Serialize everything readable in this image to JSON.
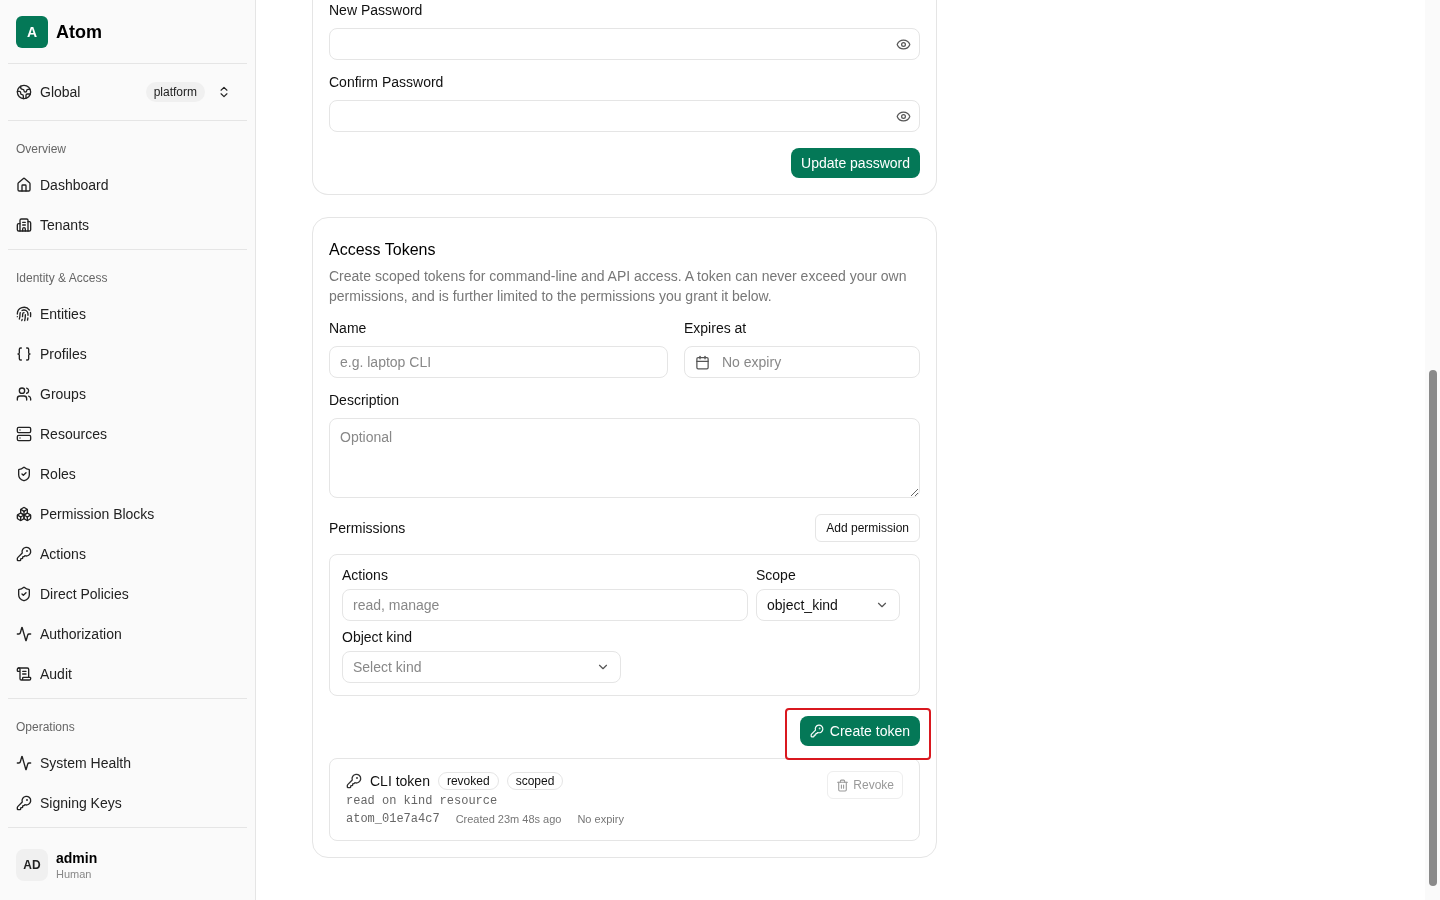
{
  "sidebar": {
    "logo_letter": "A",
    "app_name": "Atom",
    "context": {
      "label": "Global",
      "badge": "platform"
    },
    "sections": [
      {
        "title": "Overview",
        "items": [
          {
            "label": "Dashboard"
          },
          {
            "label": "Tenants"
          }
        ]
      },
      {
        "title": "Identity & Access",
        "items": [
          {
            "label": "Entities"
          },
          {
            "label": "Profiles"
          },
          {
            "label": "Groups"
          },
          {
            "label": "Resources"
          },
          {
            "label": "Roles"
          },
          {
            "label": "Permission Blocks"
          },
          {
            "label": "Actions"
          },
          {
            "label": "Direct Policies"
          },
          {
            "label": "Authorization"
          },
          {
            "label": "Audit"
          }
        ]
      },
      {
        "title": "Operations",
        "items": [
          {
            "label": "System Health"
          },
          {
            "label": "Signing Keys"
          }
        ]
      }
    ],
    "user": {
      "initials": "AD",
      "name": "admin",
      "role": "Human"
    }
  },
  "password_card": {
    "fields": [
      {
        "label": "New Password"
      },
      {
        "label": "Confirm Password"
      }
    ],
    "button": "Update password"
  },
  "tokens_card": {
    "title": "Access Tokens",
    "description": "Create scoped tokens for command-line and API access. A token can never exceed your own permissions, and is further limited to the permissions you grant it below.",
    "name_field": {
      "label": "Name",
      "placeholder": "e.g. laptop CLI"
    },
    "expires_field": {
      "label": "Expires at",
      "placeholder": "No expiry"
    },
    "description_field": {
      "label": "Description",
      "placeholder": "Optional"
    },
    "permissions": {
      "label": "Permissions",
      "add_button": "Add permission",
      "rows": [
        {
          "actions_label": "Actions",
          "actions_placeholder": "read, manage",
          "scope_label": "Scope",
          "scope_value": "object_kind",
          "kind_label": "Object kind",
          "kind_placeholder": "Select kind"
        }
      ]
    },
    "create_button": {
      "label": "Create token",
      "highlighted": true
    },
    "tokens": [
      {
        "name": "CLI token",
        "badges": [
          "revoked",
          "scoped"
        ],
        "grant": "read on kind resource",
        "id": "atom_01e7a4c7",
        "created": "Created 23m 48s ago",
        "expiry": "No expiry",
        "revoke": {
          "label": "Revoke",
          "disabled": true
        }
      }
    ]
  }
}
